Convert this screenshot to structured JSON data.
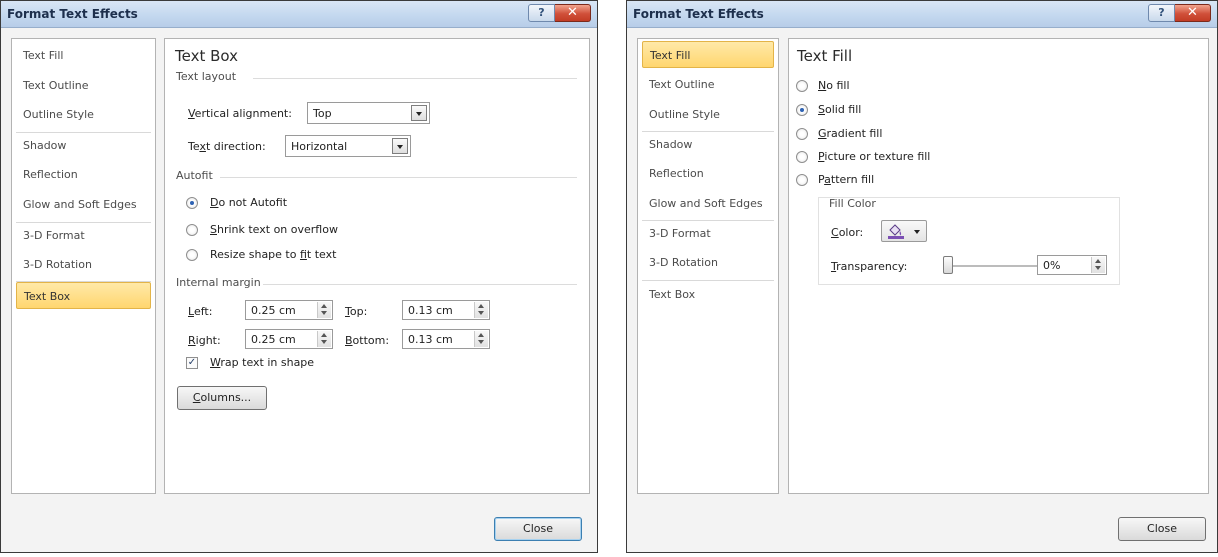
{
  "dialog_left": {
    "title": "Format Text Effects",
    "help_label": "?",
    "close_glyph": "✕",
    "nav": [
      "Text Fill",
      "Text Outline",
      "Outline Style",
      "Shadow",
      "Reflection",
      "Glow and Soft Edges",
      "3-D Format",
      "3-D Rotation",
      "Text Box"
    ],
    "selected_nav": "Text Box",
    "panel": {
      "title": "Text Box",
      "text_layout": {
        "group_label": "Text layout",
        "vertical_alignment": {
          "label_pre": "",
          "label_u": "V",
          "label_post": "ertical alignment:",
          "value": "Top"
        },
        "text_direction": {
          "label_pre": "Te",
          "label_u": "x",
          "label_post": "t direction:",
          "value": "Horizontal"
        }
      },
      "autofit": {
        "group_label": "Autofit",
        "options": [
          {
            "pre": "",
            "u": "D",
            "post": "o not Autofit",
            "selected": true
          },
          {
            "pre": "",
            "u": "S",
            "post": "hrink text on overflow",
            "selected": false
          },
          {
            "pre": "Resize shape to ",
            "u": "f",
            "post": "it text",
            "selected": false
          }
        ]
      },
      "internal_margin": {
        "group_label": "Internal margin",
        "left": {
          "pre": "",
          "u": "L",
          "post": "eft:",
          "value": "0.25 cm"
        },
        "right": {
          "pre": "",
          "u": "R",
          "post": "ight:",
          "value": "0.25 cm"
        },
        "top": {
          "pre": "",
          "u": "T",
          "post": "op:",
          "value": "0.13 cm"
        },
        "bottom": {
          "pre": "",
          "u": "B",
          "post": "ottom:",
          "value": "0.13 cm"
        }
      },
      "wrap_text": {
        "pre": "",
        "u": "W",
        "post": "rap text in shape",
        "checked": true
      },
      "columns_button": {
        "pre": "",
        "u": "C",
        "post": "olumns..."
      }
    },
    "close_button": "Close"
  },
  "dialog_right": {
    "title": "Format Text Effects",
    "help_label": "?",
    "close_glyph": "✕",
    "nav": [
      "Text Fill",
      "Text Outline",
      "Outline Style",
      "Shadow",
      "Reflection",
      "Glow and Soft Edges",
      "3-D Format",
      "3-D Rotation",
      "Text Box"
    ],
    "selected_nav": "Text Fill",
    "panel": {
      "title": "Text Fill",
      "options": [
        {
          "pre": "",
          "u": "N",
          "post": "o fill",
          "selected": false
        },
        {
          "pre": "",
          "u": "S",
          "post": "olid fill",
          "selected": true
        },
        {
          "pre": "",
          "u": "G",
          "post": "radient fill",
          "selected": false
        },
        {
          "pre": "",
          "u": "P",
          "post": "icture or texture fill",
          "selected": false
        },
        {
          "pre": "P",
          "u": "a",
          "post": "ttern fill",
          "selected": false
        }
      ],
      "fill_color": {
        "group_label": "Fill Color",
        "color_label": {
          "pre": "",
          "u": "C",
          "post": "olor:"
        },
        "transparency_label": {
          "pre": "",
          "u": "T",
          "post": "ransparency:"
        },
        "transparency_value": "0%",
        "transparency_fraction": 0
      }
    },
    "close_button": "Close"
  },
  "colors": {
    "selection": "#ffd66f",
    "titlebar": "#c4d8ef",
    "close_red": "#c23c25",
    "fill_color": "#7b4fb3"
  }
}
